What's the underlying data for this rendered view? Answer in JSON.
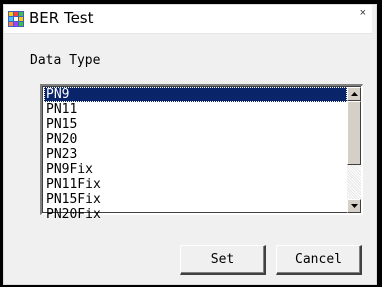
{
  "window": {
    "title": "BER Test",
    "close_glyph": "×",
    "icon": "app-grid-icon"
  },
  "form": {
    "data_type_label": "Data Type"
  },
  "listbox": {
    "items": [
      "PN9",
      "PN11",
      "PN15",
      "PN20",
      "PN23",
      "PN9Fix",
      "PN11Fix",
      "PN15Fix",
      "PN20Fix"
    ],
    "selected": "PN9"
  },
  "buttons": {
    "set_label": "Set",
    "cancel_label": "Cancel"
  },
  "colors": {
    "selection": "#0a246a",
    "dialog_bg": "#f0f0f0"
  }
}
